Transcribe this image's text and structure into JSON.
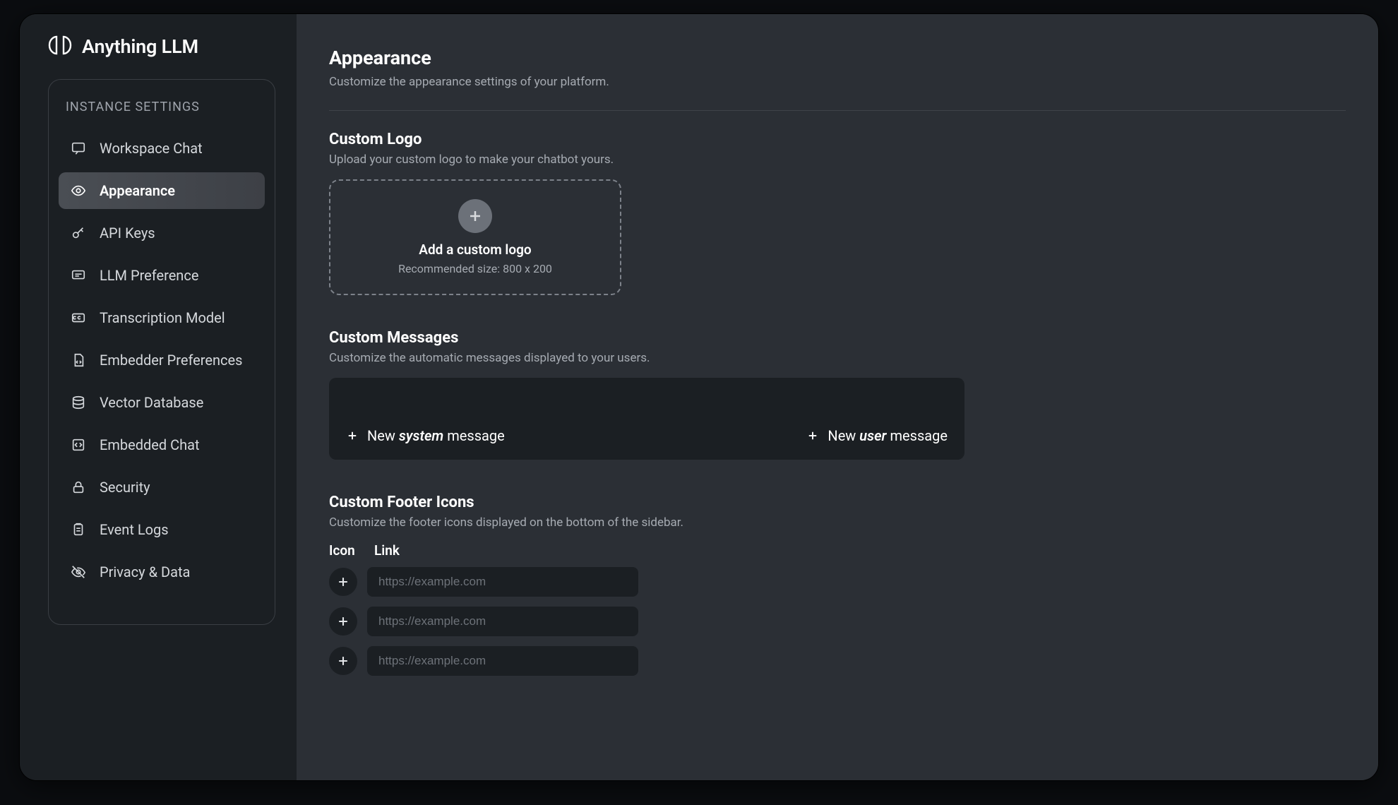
{
  "brand": {
    "name": "Anything LLM"
  },
  "sidebar": {
    "heading": "INSTANCE SETTINGS",
    "items": [
      {
        "label": "Workspace Chat"
      },
      {
        "label": "Appearance"
      },
      {
        "label": "API Keys"
      },
      {
        "label": "LLM Preference"
      },
      {
        "label": "Transcription Model"
      },
      {
        "label": "Embedder Preferences"
      },
      {
        "label": "Vector Database"
      },
      {
        "label": "Embedded Chat"
      },
      {
        "label": "Security"
      },
      {
        "label": "Event Logs"
      },
      {
        "label": "Privacy & Data"
      }
    ]
  },
  "page": {
    "title": "Appearance",
    "subtitle": "Customize the appearance settings of your platform."
  },
  "logo_section": {
    "title": "Custom Logo",
    "subtitle": "Upload your custom logo to make your chatbot yours.",
    "drop_label": "Add a custom logo",
    "drop_rec": "Recommended size: 800 x 200"
  },
  "messages_section": {
    "title": "Custom Messages",
    "subtitle": "Customize the automatic messages displayed to your users.",
    "new_prefix": "New ",
    "system_em": "system",
    "user_em": "user",
    "suffix": " message"
  },
  "footericons_section": {
    "title": "Custom Footer Icons",
    "subtitle": "Customize the footer icons displayed on the bottom of the sidebar.",
    "col_icon": "Icon",
    "col_link": "Link",
    "placeholder": "https://example.com",
    "rows": [
      {},
      {},
      {}
    ]
  }
}
